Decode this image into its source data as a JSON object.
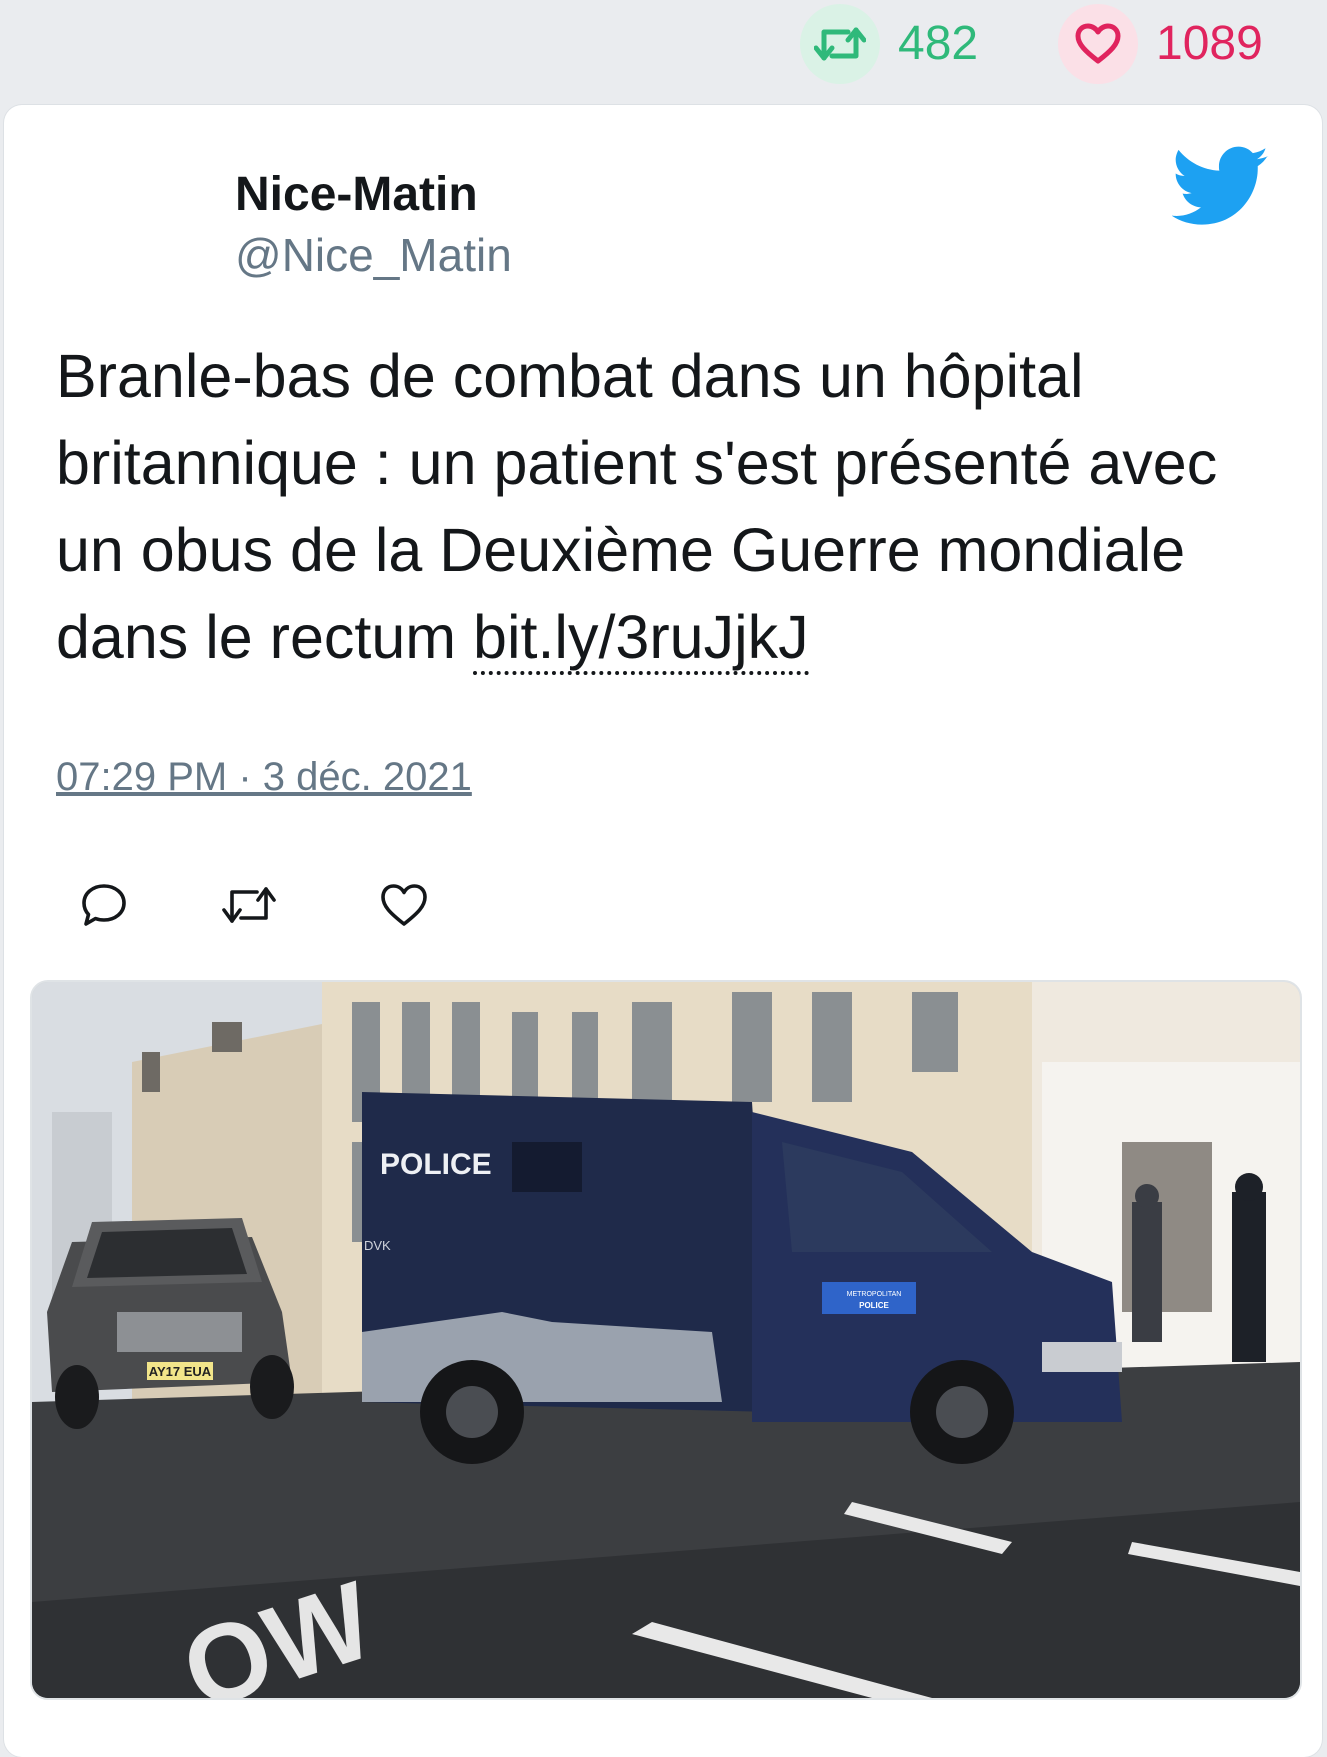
{
  "stats": {
    "retweet_icon": "retweet-icon",
    "retweet_count": "482",
    "like_icon": "heart-icon",
    "like_count": "1089"
  },
  "tweet": {
    "author_name": "Nice-Matin",
    "author_handle": "@Nice_Matin",
    "text": "Branle-bas de combat dans un hôpital britannique : un patient s'est présenté avec un obus de la Deuxième Guerre mondiale dans le rectum ",
    "link": "bit.ly/3ruJjkJ",
    "timestamp": "07:29 PM · 3 déc. 2021"
  },
  "photo": {
    "van_label": "POLICE",
    "van_code": "DVK",
    "plate": "AY17 EUA",
    "badge_line1": "METROPOLITAN",
    "badge_line2": "POLICE",
    "road_text": "OW"
  },
  "colors": {
    "retweet_green": "#2fb97a",
    "like_pink": "#e0245e",
    "twitter_blue": "#1da1f2",
    "handle_grey": "#657786"
  }
}
